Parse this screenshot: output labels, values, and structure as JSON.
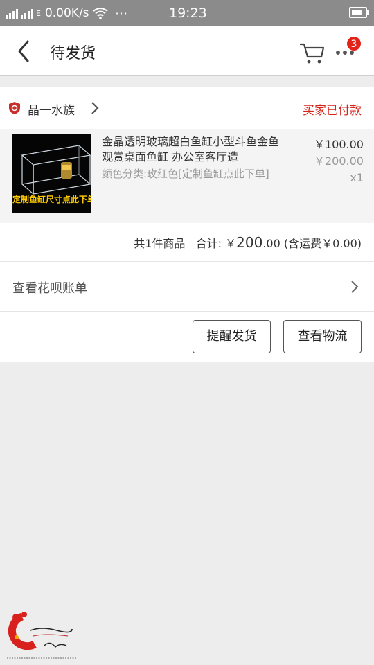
{
  "status_bar": {
    "network_speed": "0.00K/s",
    "signal_label": "E",
    "time": "19:23",
    "dots": "···"
  },
  "nav": {
    "title": "待发货",
    "notification_count": "3"
  },
  "order": {
    "shop_name": "晶一水族",
    "status": "买家已付款",
    "item": {
      "thumbnail_caption": "定制鱼缸尺寸点此下单",
      "title": "金晶透明玻璃超白鱼缸小型斗鱼金鱼观赏桌面鱼缸 办公室客厅造",
      "sku": "颜色分类:玫红色[定制鱼缸点此下单]",
      "price_now": "￥100.00",
      "price_original": "￥200.00",
      "quantity": "x1"
    },
    "summary": {
      "count_text": "共1件商品",
      "total_label": "合计: ￥",
      "total_amount": "200",
      "total_cents": ".00",
      "shipping_text": "(含运费￥0.00)"
    },
    "huabei_label": "查看花呗账单",
    "actions": {
      "remind_label": "提醒发货",
      "logistics_label": "查看物流"
    }
  },
  "colors": {
    "accent_red": "#d5241b",
    "status_bar_bg": "#8b8b8b",
    "page_bg": "#ededed"
  },
  "icons": [
    "signal-icon",
    "wifi-icon",
    "battery-icon",
    "back-arrow-icon",
    "cart-icon",
    "more-icon",
    "shop-badge-icon",
    "chevron-right-icon"
  ]
}
